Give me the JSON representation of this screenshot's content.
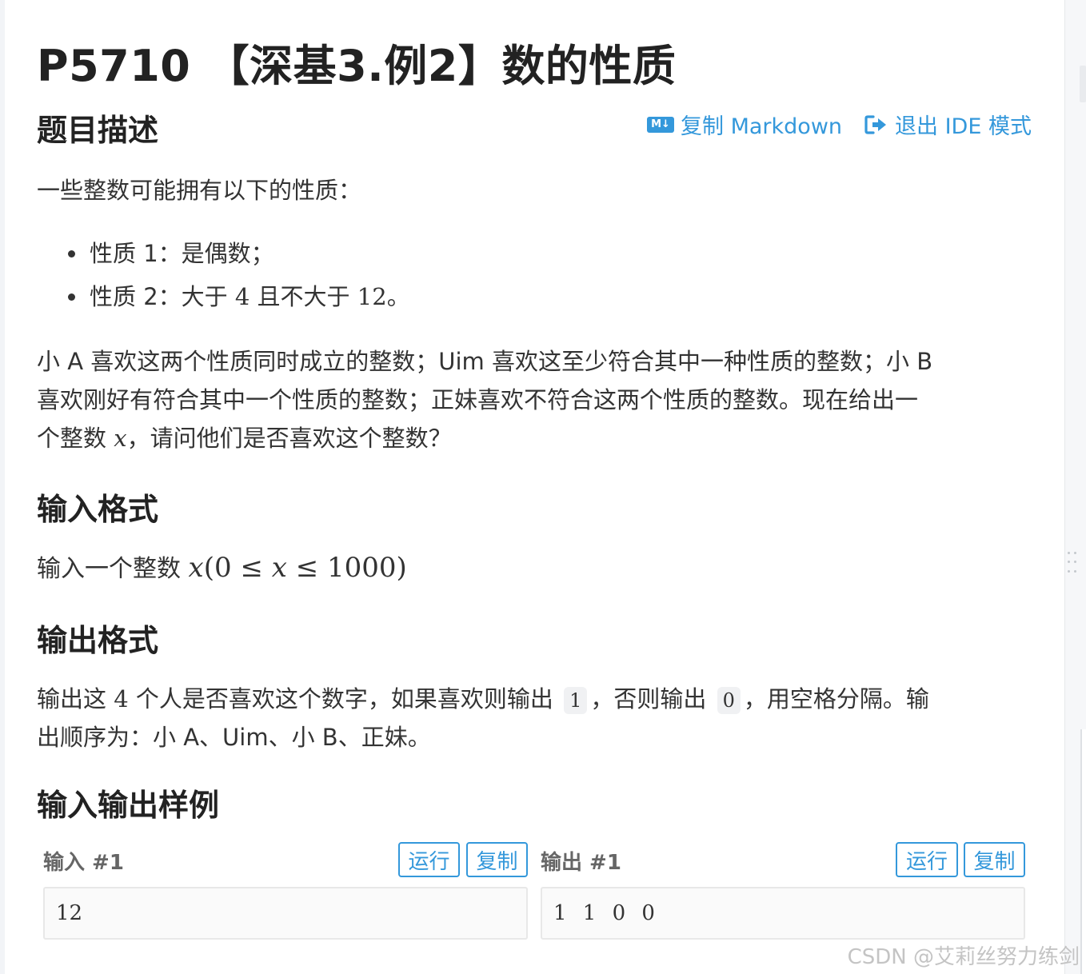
{
  "problem": {
    "title": "P5710 【深基3.例2】数的性质"
  },
  "toolbar": {
    "copy_markdown_icon": "M↓",
    "copy_markdown": "复制 Markdown",
    "exit_ide": "退出 IDE 模式"
  },
  "sections": {
    "description_heading": "题目描述",
    "input_heading": "输入格式",
    "output_heading": "输出格式",
    "samples_heading": "输入输出样例"
  },
  "description": {
    "intro": "一些整数可能拥有以下的性质：",
    "prop1_prefix": "性质 1：",
    "prop1_text": "是偶数；",
    "prop2_prefix": "性质 2：",
    "prop2_a": "大于 ",
    "prop2_num1": "4",
    "prop2_b": " 且不大于 ",
    "prop2_num2": "12",
    "prop2_end": "。",
    "body_line1": "小 A 喜欢这两个性质同时成立的整数；Uim 喜欢这至少符合其中一种性质的整数；小 B",
    "body_line2": "喜欢刚好有符合其中一个性质的整数；正妹喜欢不符合这两个性质的整数。现在给出一",
    "body_line3_a": "个整数 ",
    "body_line3_var": "x",
    "body_line3_b": "，请问他们是否喜欢这个整数？"
  },
  "input_format": {
    "text": "输入一个整数 ",
    "math_var": "x",
    "math_rest": "(0 ≤ ",
    "math_var2": "x",
    "math_rest2": " ≤ 1000)"
  },
  "output_format": {
    "a": "输出这 ",
    "num": "4",
    "b": " 个人是否喜欢这个数字，如果喜欢则输出 ",
    "code1": "1",
    "c": "，否则输出 ",
    "code0": "0",
    "d": "，用空格分隔。输",
    "line2": "出顺序为：小 A、Uim、小 B、正妹。"
  },
  "samples": {
    "input_label": "输入 #1",
    "output_label": "输出 #1",
    "run": "运行",
    "copy": "复制",
    "input_value": "12",
    "output_value": "1 1 0 0"
  },
  "watermark": "CSDN @艾莉丝努力练剑"
}
